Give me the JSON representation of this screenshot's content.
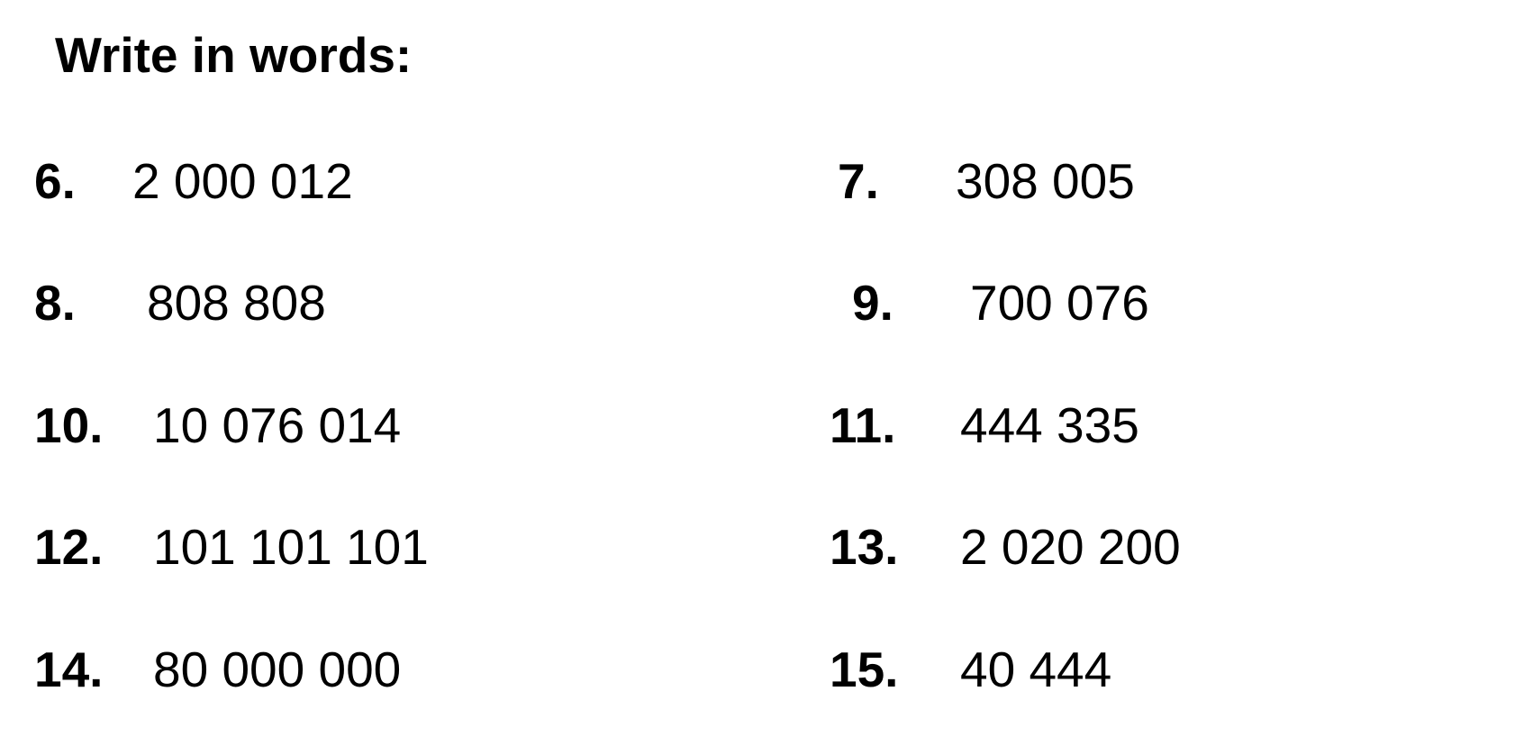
{
  "title": "Write in words:",
  "exercises": [
    {
      "number": "6.",
      "value": "2 000 012"
    },
    {
      "number": "7.",
      "value": "308 005"
    },
    {
      "number": "8.",
      "value": "808 808"
    },
    {
      "number": "9.",
      "value": "700 076"
    },
    {
      "number": "10.",
      "value": "10 076 014"
    },
    {
      "number": "11.",
      "value": "444 335"
    },
    {
      "number": "12.",
      "value": "101 101 101"
    },
    {
      "number": "13.",
      "value": "2 020 200"
    },
    {
      "number": "14.",
      "value": "80 000 000"
    },
    {
      "number": "15.",
      "value": "40 444"
    }
  ]
}
